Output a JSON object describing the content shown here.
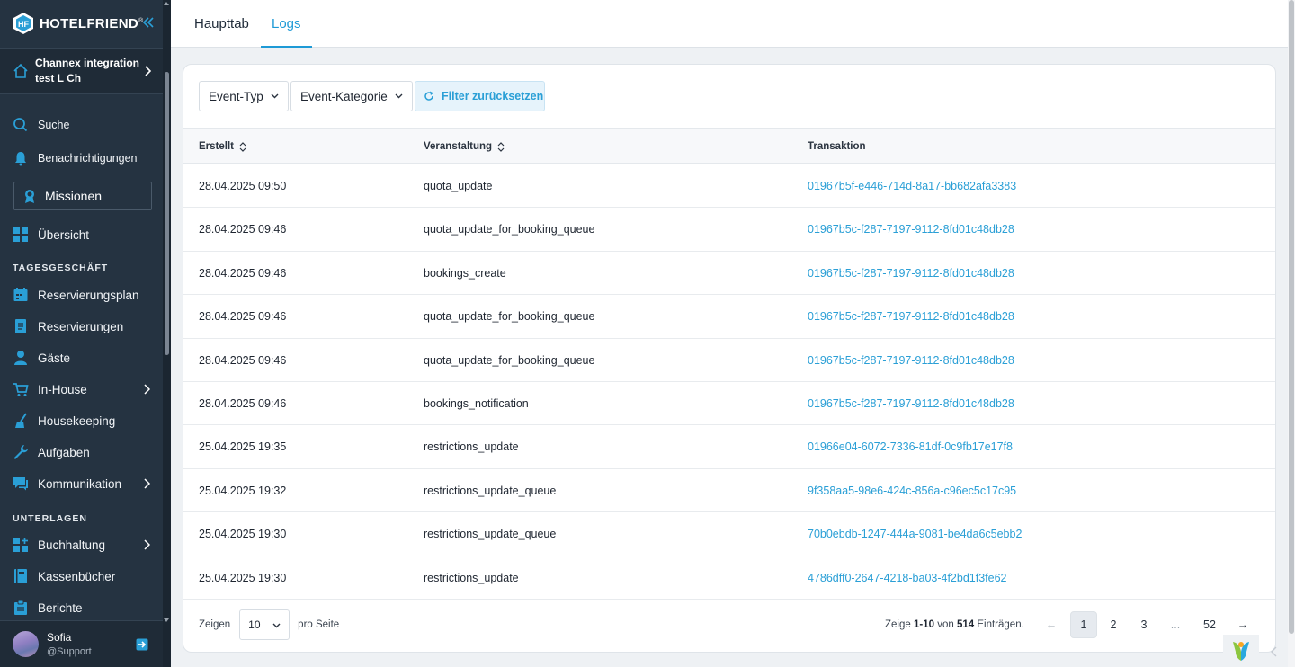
{
  "brand": {
    "name": "HOTELFRIEND",
    "mark": "®"
  },
  "hotel": {
    "name": "Channex integration test L Ch"
  },
  "nav": {
    "search": "Suche",
    "notifications": "Benachrichtigungen",
    "missions": "Missionen",
    "overview": "Übersicht",
    "section_daily": "TAGESGESCHÄFT",
    "items_daily": [
      "Reservierungsplan",
      "Reservierungen",
      "Gäste",
      "In-House",
      "Housekeeping",
      "Aufgaben",
      "Kommunikation"
    ],
    "section_docs": "UNTERLAGEN",
    "items_docs": [
      "Buchhaltung",
      "Kassenbücher",
      "Berichte"
    ]
  },
  "user": {
    "name": "Sofia",
    "role": "@Support"
  },
  "tabs": [
    "Haupttab",
    "Logs"
  ],
  "filters": {
    "event_type": "Event-Typ",
    "event_category": "Event-Kategorie",
    "reset": "Filter zurücksetzen"
  },
  "table": {
    "columns": [
      "Erstellt",
      "Veranstaltung",
      "Transaktion"
    ],
    "rows": [
      [
        "28.04.2025 09:50",
        "quota_update",
        "01967b5f-e446-714d-8a17-bb682afa3383"
      ],
      [
        "28.04.2025 09:46",
        "quota_update_for_booking_queue",
        "01967b5c-f287-7197-9112-8fd01c48db28"
      ],
      [
        "28.04.2025 09:46",
        "bookings_create",
        "01967b5c-f287-7197-9112-8fd01c48db28"
      ],
      [
        "28.04.2025 09:46",
        "quota_update_for_booking_queue",
        "01967b5c-f287-7197-9112-8fd01c48db28"
      ],
      [
        "28.04.2025 09:46",
        "quota_update_for_booking_queue",
        "01967b5c-f287-7197-9112-8fd01c48db28"
      ],
      [
        "28.04.2025 09:46",
        "bookings_notification",
        "01967b5c-f287-7197-9112-8fd01c48db28"
      ],
      [
        "25.04.2025 19:35",
        "restrictions_update",
        "01966e04-6072-7336-81df-0c9fb17e17f8"
      ],
      [
        "25.04.2025 19:32",
        "restrictions_update_queue",
        "9f358aa5-98e6-424c-856a-c96ec5c17c95"
      ],
      [
        "25.04.2025 19:30",
        "restrictions_update_queue",
        "70b0ebdb-1247-444a-9081-be4da6c5ebb2"
      ],
      [
        "25.04.2025 19:30",
        "restrictions_update",
        "4786dff0-2647-4218-ba03-4f2bd1f3fe62"
      ]
    ]
  },
  "pagination": {
    "show_label": "Zeigen",
    "per_page": "10",
    "per_page_label": "pro Seite",
    "summary_prefix": "Zeige",
    "range": "1-10",
    "summary_mid": "von",
    "total": "514",
    "summary_suffix": "Einträgen.",
    "prev": "←",
    "pages": [
      "1",
      "2",
      "3",
      "...",
      "52"
    ],
    "next": "→"
  },
  "colors": {
    "sidebar": "#253341",
    "accent": "#1e9ad6"
  }
}
